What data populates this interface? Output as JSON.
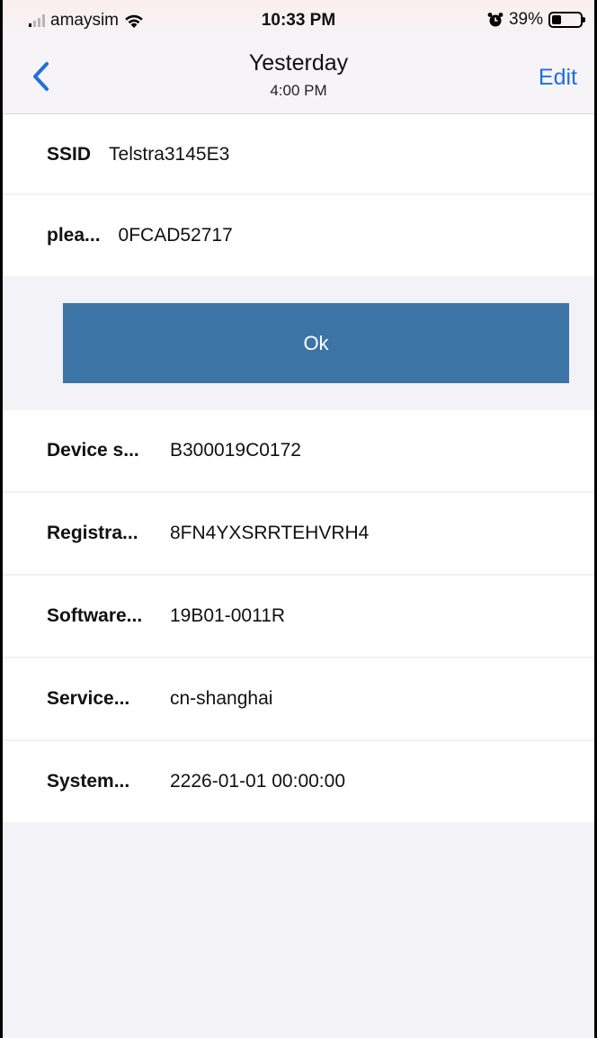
{
  "status_bar": {
    "carrier": "amaysim",
    "time": "10:33 PM",
    "battery_percent": "39%",
    "icons": [
      "signal-icon",
      "wifi-icon",
      "alarm-icon",
      "battery-icon"
    ]
  },
  "nav": {
    "title": "Yesterday",
    "subtitle": "4:00 PM",
    "edit_label": "Edit",
    "back_icon": "chevron-left-icon"
  },
  "wifi_fields": [
    {
      "label": "SSID",
      "value": "Telstra3145E3"
    },
    {
      "label": "plea...",
      "value": "0FCAD52717"
    }
  ],
  "ok_button": {
    "label": "Ok"
  },
  "device_fields": [
    {
      "label": "Device s...",
      "value": "B300019C0172"
    },
    {
      "label": "Registra...",
      "value": "8FN4YXSRRTEHVRH4"
    },
    {
      "label": "Software...",
      "value": "19B01-0011R"
    },
    {
      "label": "Service...",
      "value": "cn-shanghai"
    },
    {
      "label": "System...",
      "value": "2226-01-01 00:00:00"
    }
  ],
  "colors": {
    "accent": "#1f6fde",
    "button": "#3d74a6",
    "background": "#f2f2f7"
  }
}
